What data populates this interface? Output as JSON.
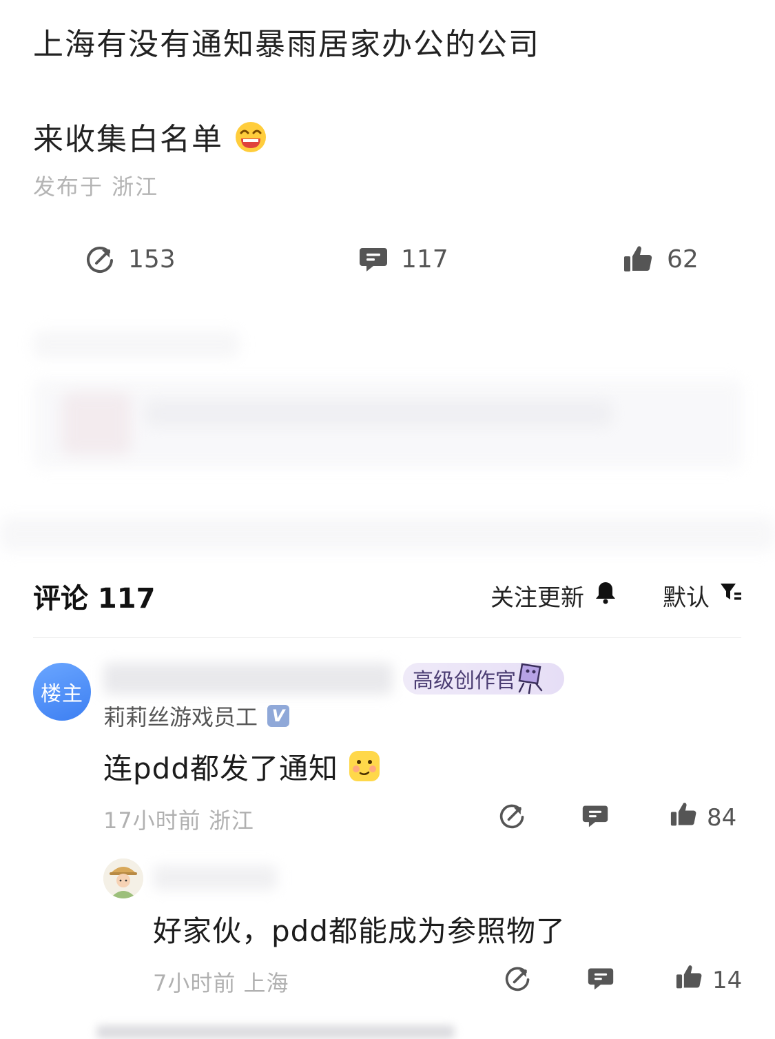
{
  "post": {
    "title": "上海有没有通知暴雨居家办公的公司",
    "body": "来收集白名单",
    "body_emoji": "laughing-emoji",
    "meta": "发布于 浙江",
    "stats": {
      "share_count": "153",
      "comment_count": "117",
      "like_count": "62"
    }
  },
  "comments": {
    "header": "评论 117",
    "follow_label": "关注更新",
    "sort_label": "默认",
    "items": [
      {
        "avatar_text": "楼主",
        "badge": "高级创作官",
        "user_tag": "莉莉丝游戏员工",
        "verified_mark": "V",
        "text": "连pdd都发了通知",
        "emoji": "smirk-emoji",
        "meta": "17小时前  浙江",
        "likes": "84"
      },
      {
        "text": "好家伙，pdd都能成为参照物了",
        "meta": "7小时前  上海",
        "likes": "14"
      }
    ]
  },
  "colors": {
    "accent_blue": "#3d7ff2",
    "text_gray": "#b0b0b0",
    "icon_gray": "#555555"
  }
}
